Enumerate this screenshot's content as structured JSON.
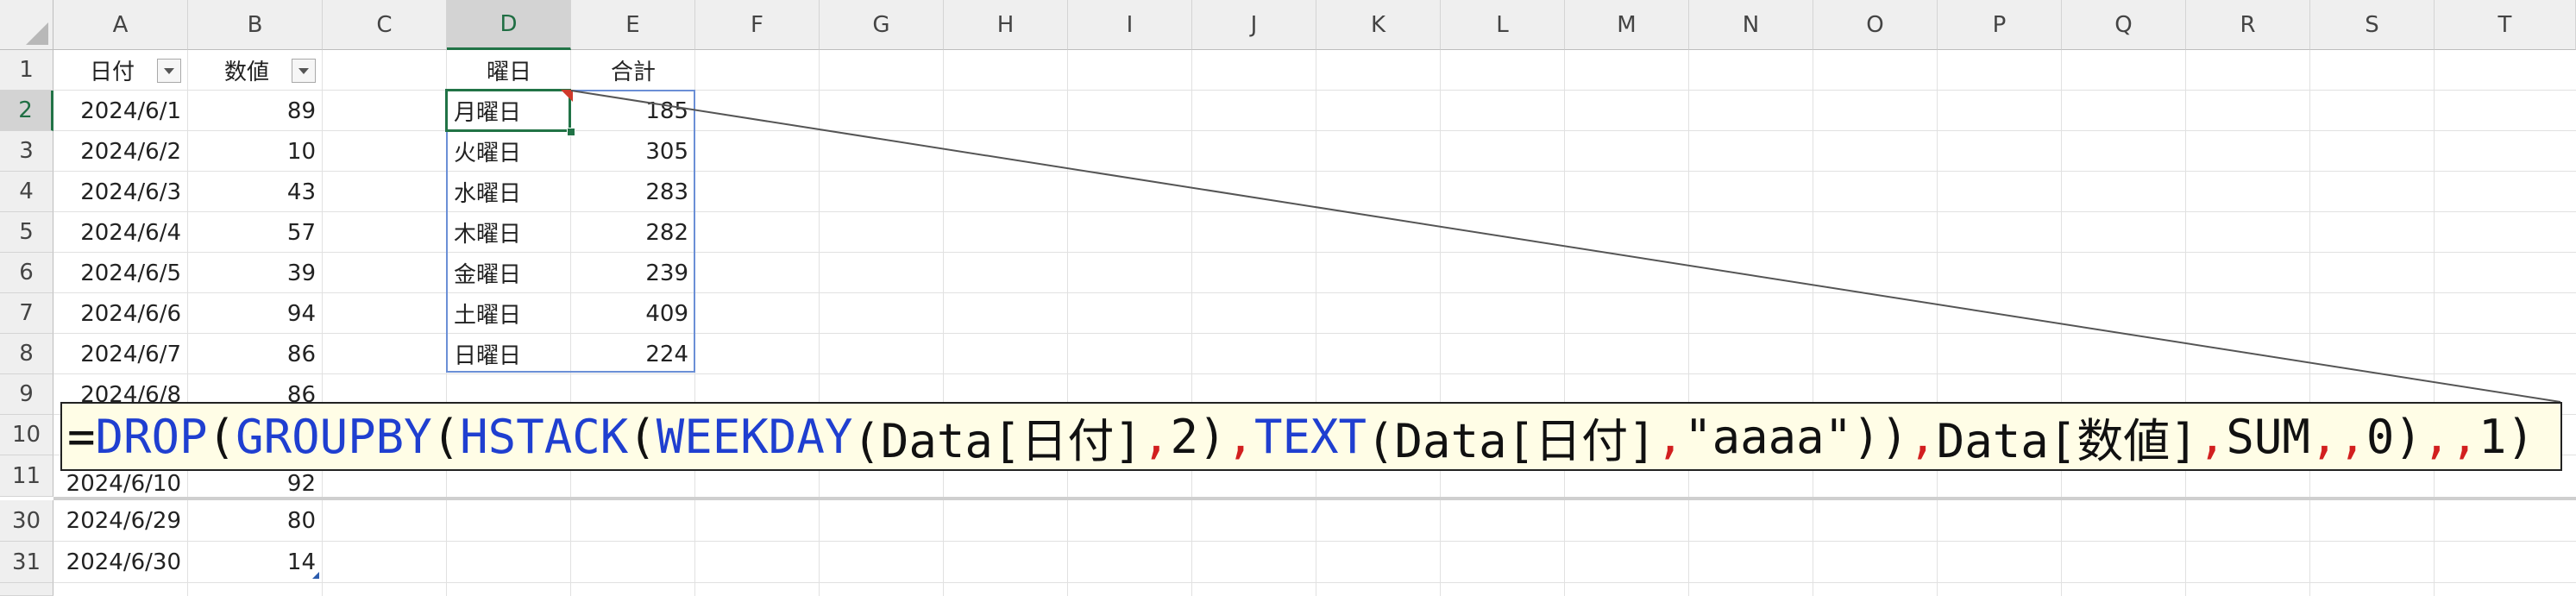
{
  "columns": [
    "A",
    "B",
    "C",
    "D",
    "E",
    "F",
    "G",
    "H",
    "I",
    "J",
    "K",
    "L",
    "M",
    "N",
    "O",
    "P",
    "Q",
    "R",
    "S",
    "T"
  ],
  "selected_column": "D",
  "rows": [
    "1",
    "2",
    "3",
    "4",
    "5",
    "6",
    "7",
    "8",
    "9",
    "10",
    "11",
    "30",
    "31"
  ],
  "selected_row": "2",
  "header_row": {
    "a": "日付",
    "b": "数値",
    "d": "曜日",
    "e": "合計"
  },
  "source_rows": [
    {
      "date": "2024/6/1",
      "value": "89"
    },
    {
      "date": "2024/6/2",
      "value": "10"
    },
    {
      "date": "2024/6/3",
      "value": "43"
    },
    {
      "date": "2024/6/4",
      "value": "57"
    },
    {
      "date": "2024/6/5",
      "value": "39"
    },
    {
      "date": "2024/6/6",
      "value": "94"
    },
    {
      "date": "2024/6/7",
      "value": "86"
    },
    {
      "date": "2024/6/8",
      "value": "86"
    },
    {
      "date": "2024/6/10",
      "value": "92"
    },
    {
      "date": "2024/6/29",
      "value": "80"
    },
    {
      "date": "2024/6/30",
      "value": "14"
    }
  ],
  "spill_results": [
    {
      "weekday": "月曜日",
      "total": "185"
    },
    {
      "weekday": "火曜日",
      "total": "305"
    },
    {
      "weekday": "水曜日",
      "total": "283"
    },
    {
      "weekday": "木曜日",
      "total": "282"
    },
    {
      "weekday": "金曜日",
      "total": "239"
    },
    {
      "weekday": "土曜日",
      "total": "409"
    },
    {
      "weekday": "日曜日",
      "total": "224"
    }
  ],
  "formula_tokens": [
    {
      "text": "=",
      "color": "#111111"
    },
    {
      "text": "DROP",
      "color": "#1f3fd0"
    },
    {
      "text": "(",
      "color": "#111111"
    },
    {
      "text": "GROUPBY",
      "color": "#1f3fd0"
    },
    {
      "text": "(",
      "color": "#111111"
    },
    {
      "text": "HSTACK",
      "color": "#1f3fd0"
    },
    {
      "text": "(",
      "color": "#111111"
    },
    {
      "text": "WEEKDAY",
      "color": "#1f3fd0"
    },
    {
      "text": "(Data[日付]",
      "color": "#111111"
    },
    {
      "text": ",",
      "color": "#d21f1f"
    },
    {
      "text": "2)",
      "color": "#111111"
    },
    {
      "text": ",",
      "color": "#d21f1f"
    },
    {
      "text": "TEXT",
      "color": "#1f3fd0"
    },
    {
      "text": "(Data[日付]",
      "color": "#111111"
    },
    {
      "text": ",",
      "color": "#d21f1f"
    },
    {
      "text": "\"aaaa\"))",
      "color": "#111111"
    },
    {
      "text": ",",
      "color": "#d21f1f"
    },
    {
      "text": "Data[数値]",
      "color": "#111111"
    },
    {
      "text": ",",
      "color": "#d21f1f"
    },
    {
      "text": "SUM",
      "color": "#111111"
    },
    {
      "text": ",",
      "color": "#d21f1f"
    },
    {
      "text": ",",
      "color": "#d21f1f"
    },
    {
      "text": "0)",
      "color": "#111111"
    },
    {
      "text": ",",
      "color": "#d21f1f"
    },
    {
      "text": ",",
      "color": "#d21f1f"
    },
    {
      "text": "1)",
      "color": "#111111"
    }
  ],
  "colors": {
    "selection_green": "#217346",
    "spill_border": "#6b8fd6",
    "header_bg": "#efefef",
    "callout_bg": "#fffde6",
    "comment_marker": "#d0392b"
  }
}
